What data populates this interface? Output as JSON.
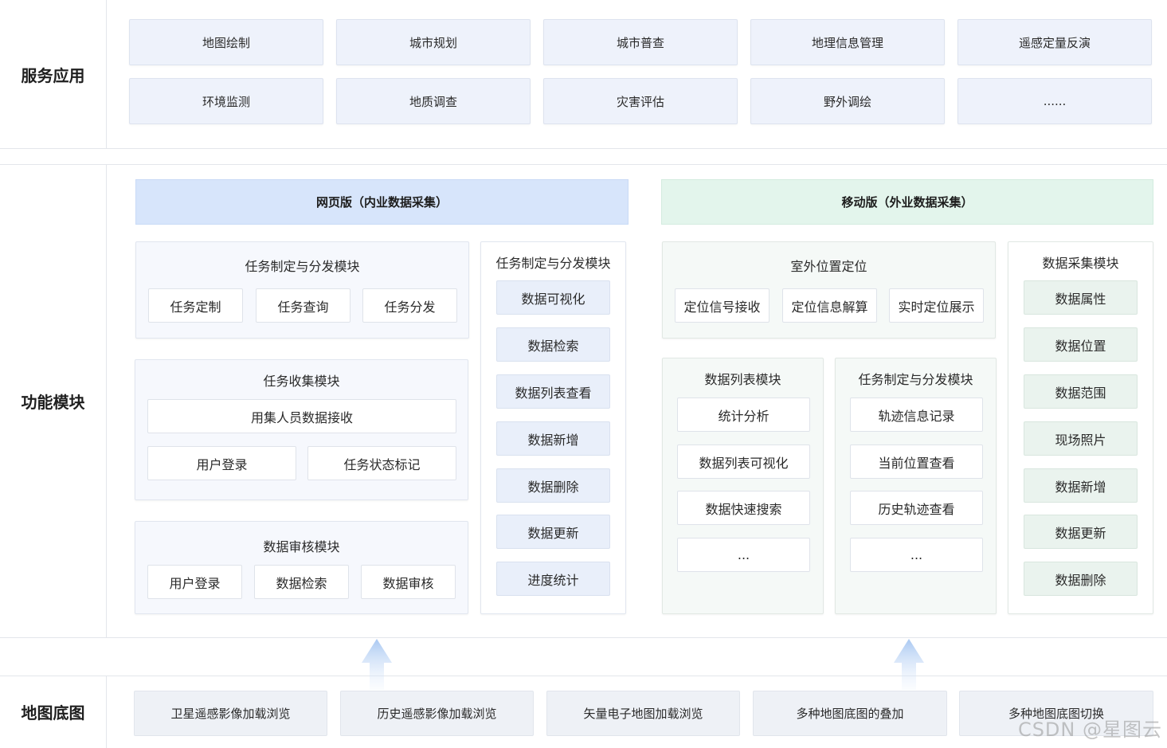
{
  "rows": {
    "service": "服务应用",
    "function": "功能模块",
    "basemap": "地图底图"
  },
  "services": [
    "地图绘制",
    "城市规划",
    "城市普查",
    "地理信息管理",
    "遥感定量反演",
    "环境监测",
    "地质调查",
    "灾害评估",
    "野外调绘",
    "......"
  ],
  "web": {
    "header": "网页版（内业数据采集）",
    "task_dispatch": {
      "title": "任务制定与分发模块",
      "items": [
        "任务定制",
        "任务查询",
        "任务分发"
      ]
    },
    "task_collect": {
      "title": "任务收集模块",
      "items": [
        "用集人员数据接收",
        "用户登录",
        "任务状态标记"
      ]
    },
    "data_review": {
      "title": "数据审核模块",
      "items": [
        "用户登录",
        "数据检索",
        "数据审核"
      ]
    },
    "data_side": {
      "title": "任务制定与分发模块",
      "items": [
        "数据可视化",
        "数据检索",
        "数据列表查看",
        "数据新增",
        "数据删除",
        "数据更新",
        "进度统计"
      ]
    }
  },
  "mobile": {
    "header": "移动版（外业数据采集）",
    "positioning": {
      "title": "室外位置定位",
      "items": [
        "定位信号接收",
        "定位信息解算",
        "实时定位展示"
      ]
    },
    "data_list": {
      "title": "数据列表模块",
      "items": [
        "统计分析",
        "数据列表可视化",
        "数据快速搜索",
        "..."
      ]
    },
    "task_track": {
      "title": "任务制定与分发模块",
      "items": [
        "轨迹信息记录",
        "当前位置查看",
        "历史轨迹查看",
        "..."
      ]
    },
    "collect": {
      "title": "数据采集模块",
      "items": [
        "数据属性",
        "数据位置",
        "数据范围",
        "现场照片",
        "数据新增",
        "数据更新",
        "数据删除"
      ]
    }
  },
  "basemaps": [
    "卫星遥感影像加载浏览",
    "历史遥感影像加载浏览",
    "矢量电子地图加载浏览",
    "多种地图底图的叠加",
    "多种地图底图切换"
  ],
  "watermark": "CSDN @星图云",
  "colors": {
    "web_header": "#d7e5fb",
    "mobile_header": "#e3f5ec",
    "arrow": "#a9c8f2"
  }
}
